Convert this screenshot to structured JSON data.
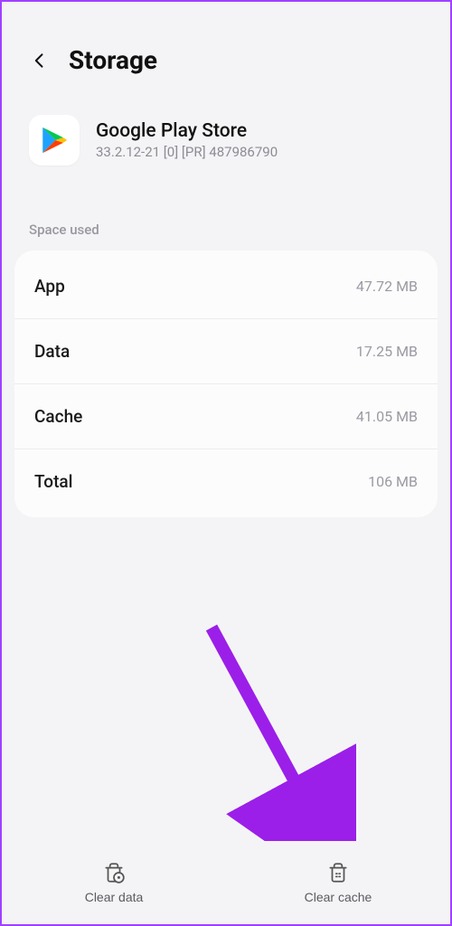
{
  "header": {
    "title": "Storage"
  },
  "app": {
    "name": "Google Play Store",
    "version": "33.2.12-21 [0] [PR] 487986790"
  },
  "section_label": "Space used",
  "rows": [
    {
      "label": "App",
      "value": "47.72 MB"
    },
    {
      "label": "Data",
      "value": "17.25 MB"
    },
    {
      "label": "Cache",
      "value": "41.05 MB"
    },
    {
      "label": "Total",
      "value": "106 MB"
    }
  ],
  "actions": {
    "clear_data": "Clear data",
    "clear_cache": "Clear cache"
  },
  "colors": {
    "accent_arrow": "#9b1fe8"
  }
}
